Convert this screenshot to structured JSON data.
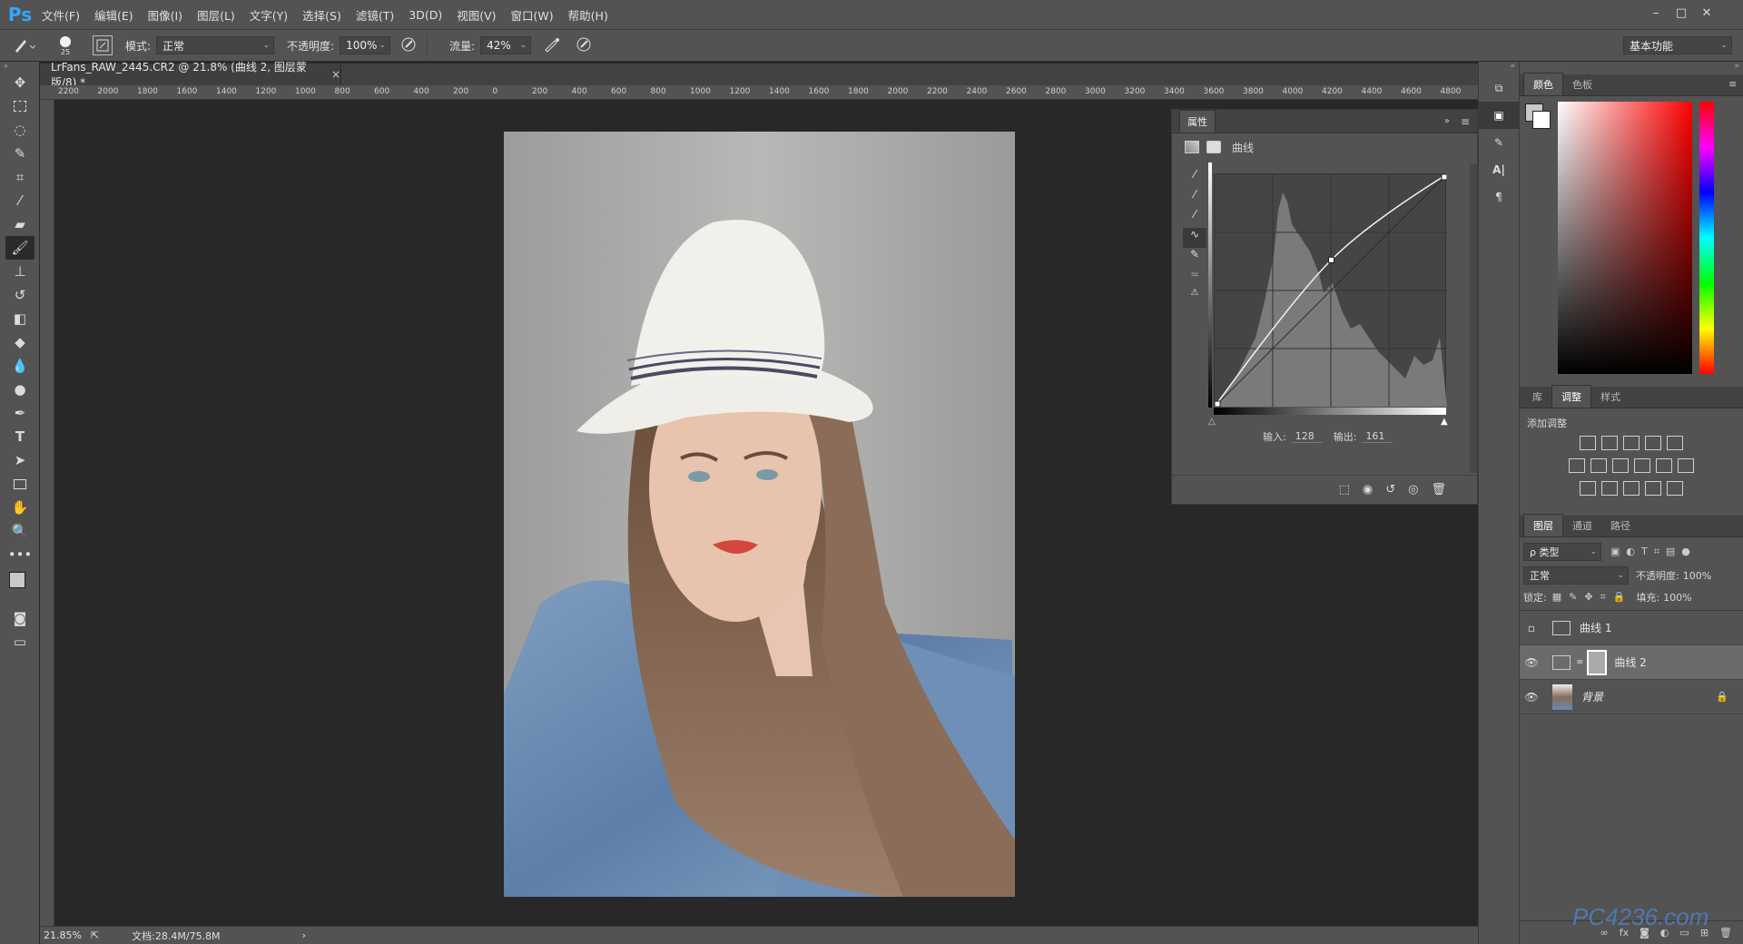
{
  "menubar": {
    "logo": "Ps",
    "items": [
      "文件(F)",
      "编辑(E)",
      "图像(I)",
      "图层(L)",
      "文字(Y)",
      "选择(S)",
      "滤镜(T)",
      "3D(D)",
      "视图(V)",
      "窗口(W)",
      "帮助(H)"
    ],
    "window_controls": [
      "–",
      "□",
      "✕"
    ]
  },
  "options": {
    "brush_size": "25",
    "mode_label": "模式:",
    "mode_value": "正常",
    "opacity_label": "不透明度:",
    "opacity_value": "100%",
    "flow_label": "流量:",
    "flow_value": "42%",
    "workspace": "基本功能"
  },
  "document": {
    "tab_title": "LrFans_RAW_2445.CR2 @ 21.8% (曲线 2, 图层蒙版/8) *",
    "close": "×"
  },
  "ruler_labels": [
    "2200",
    "2000",
    "1800",
    "1600",
    "1400",
    "1200",
    "1000",
    "800",
    "600",
    "400",
    "200",
    "0",
    "200",
    "400",
    "600",
    "800",
    "1000",
    "1200",
    "1400",
    "1600",
    "1800",
    "2000",
    "2200",
    "2400",
    "2600",
    "2800",
    "3000",
    "3200",
    "3400",
    "3600",
    "3800",
    "4000",
    "4200",
    "4400",
    "4600",
    "4800"
  ],
  "status": {
    "zoom": "21.85%",
    "doc_size": "文档:28.4M/75.8M",
    "arrow": "›"
  },
  "properties": {
    "tab": "属性",
    "type_label": "曲线",
    "input_label": "输入:",
    "input_value": "128",
    "output_label": "输出:",
    "output_value": "161",
    "curve_point": {
      "input": 128,
      "output": 161
    }
  },
  "right_panel": {
    "color_tabs": [
      "颜色",
      "色板"
    ],
    "adjust_tabs": [
      "库",
      "调整",
      "样式"
    ],
    "add_adjustment": "添加调整",
    "layers_tabs": [
      "图层",
      "通道",
      "路径"
    ],
    "kind_label": "ρ 类型",
    "blend_mode": "正常",
    "opacity_label": "不透明度:",
    "opacity_value": "100%",
    "lock_label": "锁定:",
    "fill_label": "填充:",
    "fill_value": "100%",
    "layers": [
      {
        "name": "曲线 1",
        "visible": false
      },
      {
        "name": "曲线 2",
        "visible": true
      },
      {
        "name": "背景",
        "visible": true
      }
    ],
    "watermark": "PC4236.com"
  }
}
